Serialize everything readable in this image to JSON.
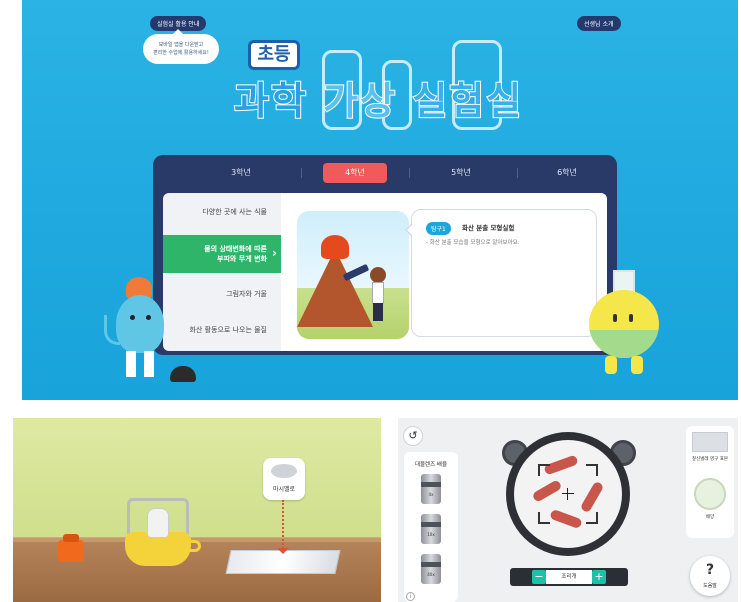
{
  "top": {
    "guide_button": "실험실 활용 안내",
    "teacher_button": "선생님 소개",
    "bubble_line1": "모바일 앱을 다운받고",
    "bubble_line2": "편리한 수업에 활용하세요!",
    "title_small": "초등",
    "title_main_1": "과학",
    "title_main_2": "가상",
    "title_main_3": "실험실",
    "grades": [
      "3학년",
      "4학년",
      "5학년",
      "6학년"
    ],
    "active_grade": "4학년",
    "menu": [
      {
        "label": "다양한 곳에 사는 식물"
      },
      {
        "label_line1": "물의 상태변화에 따른",
        "label_line2": "부피와 무게 변화"
      },
      {
        "label": "그림자와 거울"
      },
      {
        "label": "화산 활동으로 나오는 물질"
      }
    ],
    "content": {
      "tag": "탐구1",
      "title": "화산 분출 모형실험",
      "description": "- 화산 분출 모습을 모형으로 알아보아요."
    }
  },
  "bottom_left": {
    "item_label": "마시멜로"
  },
  "bottom_right": {
    "back_icon": "↺",
    "lens_title": "대물렌즈 배율",
    "lenses": [
      "4x",
      "10x",
      "40x"
    ],
    "focus_label": "조리개",
    "minus": "−",
    "plus": "+",
    "slide_label": "짚신벌레 영구 표본",
    "dish_label": "배양",
    "help_label": "도움말",
    "help_icon": "?",
    "info_icon": "i"
  },
  "colors": {
    "top_bg": "#1fa9df",
    "card_bg": "#2a3a68",
    "active_grade": "#f05a5a",
    "active_menu": "#2fb56a",
    "tag": "#1aa7de",
    "focus_button": "#1fbfa8"
  }
}
